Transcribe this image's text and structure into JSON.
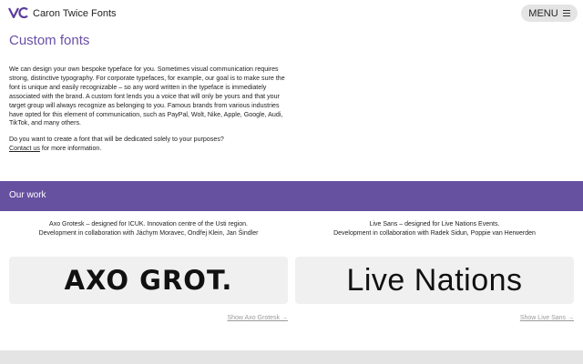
{
  "header": {
    "brand": "Caron Twice Fonts",
    "menu_label": "MENU",
    "logo_icon": "cv-logo-icon",
    "menu_icon": "hamburger-icon"
  },
  "main": {
    "title": "Custom fonts",
    "intro": "We can design your own bespoke typeface for you. Sometimes visual communication requires strong, distinctive typography. For corporate typefaces, for example, our goal is to make sure the font is unique and easily recognizable – so any word written in the typeface is immediately associated with the brand. A custom font lends you a voice that will only be yours and that your target group will always recognize as belonging to you. Famous brands from various industries have opted for this element of communication, such as PayPal, Wolt, Nike, Apple, Google, Audi, TikTok, and many others.",
    "question": "Do you want to create a font that will be dedicated solely to your purposes?",
    "contact_link": "Contact us",
    "contact_suffix": " for more information."
  },
  "our_work": {
    "title": "Our work",
    "items": [
      {
        "caption_line1": "Axo Grotesk – designed for ICUK. Innovation centre of the Usti region.",
        "caption_line2": "Development in collaboration with Jáchym Moravec, Ondřej Klein, Jan Šindler",
        "preview": "AXO GROT.",
        "link": "Show Axo Grotesk →"
      },
      {
        "caption_line1": "Live Sans – designed for Live Nations Events.",
        "caption_line2": "Development in collaboration with Radek Sidun, Poppie van Herwerden",
        "preview": "Live Nations",
        "link": "Show Live Sans →"
      }
    ]
  },
  "colors": {
    "accent": "#6650a0",
    "title": "#6a4fa6",
    "menu_bg": "#e4e4e4",
    "preview_bg": "#f0f0f0"
  }
}
